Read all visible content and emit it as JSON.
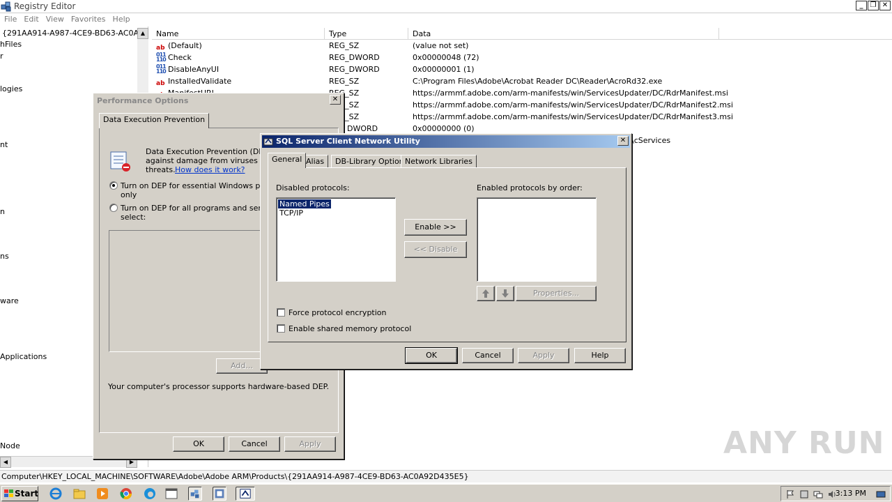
{
  "registry": {
    "title": "Registry Editor",
    "menu": [
      "File",
      "Edit",
      "View",
      "Favorites",
      "Help"
    ],
    "tree": {
      "header": "{291AA914-A987-4CE9-BD63-AC0A92D",
      "items": [
        "hFiles",
        "r",
        "logies",
        "nt",
        "n",
        "ns",
        "ware",
        "Applications",
        "Node"
      ]
    },
    "columns": [
      "Name",
      "Type",
      "Data"
    ],
    "values": [
      {
        "icon": "string-value-icon",
        "name": "(Default)",
        "type": "REG_SZ",
        "data": "(value not set)"
      },
      {
        "icon": "dword-value-icon",
        "name": "Check",
        "type": "REG_DWORD",
        "data": "0x00000048 (72)"
      },
      {
        "icon": "dword-value-icon",
        "name": "DisableAnyUI",
        "type": "REG_DWORD",
        "data": "0x00000001 (1)"
      },
      {
        "icon": "string-value-icon",
        "name": "InstalledValidate",
        "type": "REG_SZ",
        "data": "C:\\Program Files\\Adobe\\Acrobat Reader DC\\Reader\\AcroRd32.exe"
      },
      {
        "icon": "string-value-icon",
        "name": "ManifestURL",
        "type": "REG_SZ",
        "data": "https://armmf.adobe.com/arm-manifests/win/ServicesUpdater/DC/RdrManifest.msi"
      },
      {
        "icon": "string-value-icon",
        "name": "",
        "type": "REG_SZ",
        "data": "https://armmf.adobe.com/arm-manifests/win/ServicesUpdater/DC/RdrManifest2.msi"
      },
      {
        "icon": "string-value-icon",
        "name": "",
        "type": "REG_SZ",
        "data": "https://armmf.adobe.com/arm-manifests/win/ServicesUpdater/DC/RdrManifest3.msi"
      },
      {
        "icon": "dword-value-icon",
        "name": "",
        "type": "DWORD",
        "data": "0x00000000 (0)"
      },
      {
        "icon": "",
        "name": "",
        "type": "",
        "data": "\\cServices"
      }
    ],
    "status": "Computer\\HKEY_LOCAL_MACHINE\\SOFTWARE\\Adobe\\Adobe ARM\\Products\\{291AA914-A987-4CE9-BD63-AC0A92D435E5}"
  },
  "perf": {
    "title": "Performance Options",
    "tab": "Data Execution Prevention",
    "desc_line1": "Data Execution Prevention (DEP) h",
    "desc_line2": "against damage from viruses and",
    "desc_line3": "threats.",
    "link": "How does it work?",
    "radio1_line1": "Turn on DEP for essential Windows progra",
    "radio1_line2": "only",
    "radio2_line1": "Turn on DEP for all programs and services",
    "radio2_line2": "select:",
    "add_button": "Add...",
    "hw_note": "Your computer's processor supports hardware-based DEP.",
    "ok": "OK",
    "cancel": "Cancel",
    "apply": "Apply"
  },
  "sql": {
    "title": "SQL Server Client Network Utility",
    "tabs": [
      "General",
      "Alias",
      "DB-Library Options",
      "Network Libraries"
    ],
    "disabled_label": "Disabled protocols:",
    "enabled_label": "Enabled protocols by order:",
    "disabled_protocols": [
      "Named Pipes",
      "TCP/IP"
    ],
    "enable_button": "Enable >>",
    "disable_button": "<< Disable",
    "properties_button": "Properties...",
    "force_encryption": "Force protocol encryption",
    "shared_memory": "Enable shared memory protocol",
    "ok": "OK",
    "cancel": "Cancel",
    "apply": "Apply",
    "help": "Help"
  },
  "taskbar": {
    "start": "Start",
    "clock": "3:13 PM"
  },
  "watermark": "ANY RUN"
}
